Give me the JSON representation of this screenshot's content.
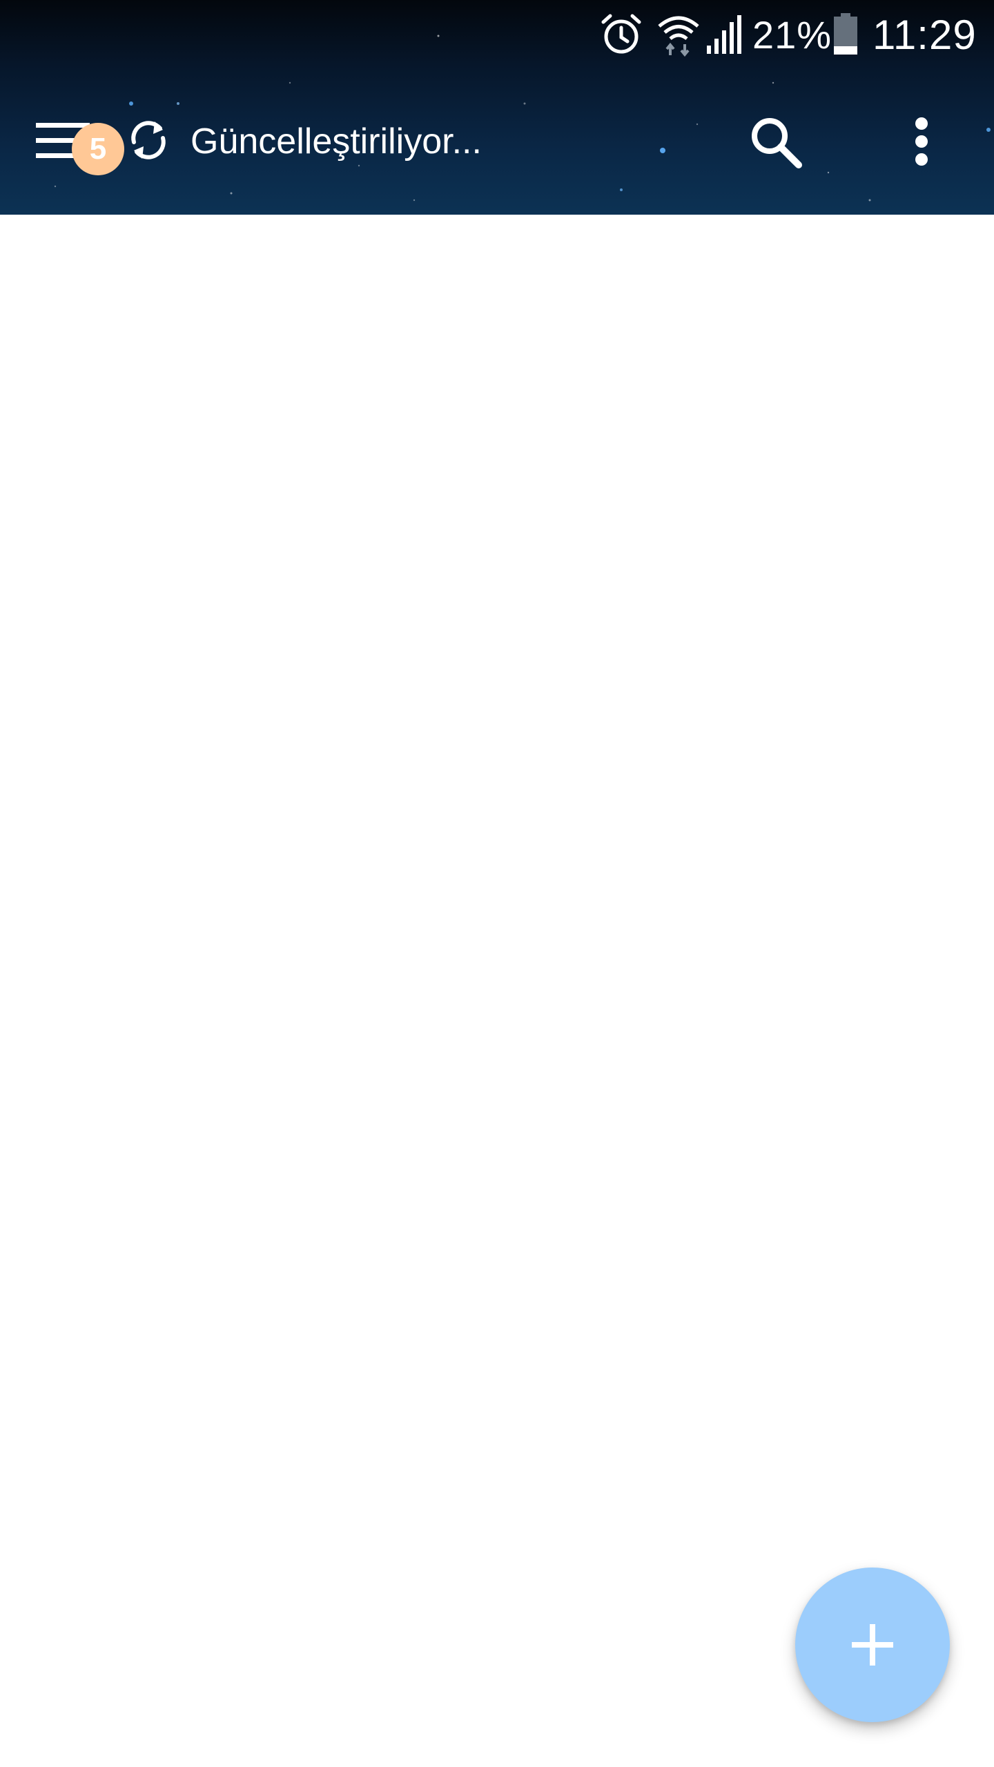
{
  "status_bar": {
    "battery_percent": "21%",
    "time": "11:29",
    "icons": [
      "alarm-icon",
      "wifi-icon",
      "signal-icon",
      "battery-icon"
    ]
  },
  "toolbar": {
    "title": "Güncelleştiriliyor...",
    "badge_count": "5",
    "icons": [
      "menu-icon",
      "sync-icon",
      "search-icon",
      "more-vert-icon"
    ]
  },
  "fab": {
    "icon": "plus-icon"
  },
  "colors": {
    "header_top": "#03070d",
    "header_bottom": "#0c3254",
    "badge": "#ffc896",
    "fab": "#9ccdfc",
    "background": "#ffffff"
  }
}
